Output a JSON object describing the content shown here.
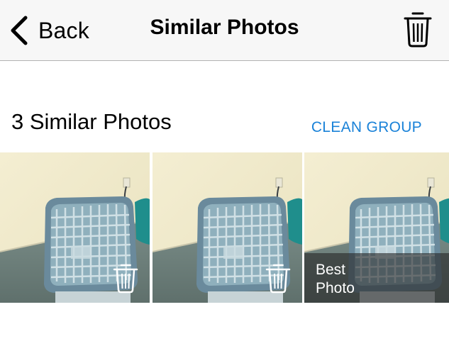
{
  "navbar": {
    "back_label": "Back",
    "title": "Similar Photos",
    "back_icon": "chevron-left-icon",
    "trash_icon": "trash-icon"
  },
  "group": {
    "title": "3 Similar Photos",
    "clean_label": "CLEAN GROUP",
    "accent_color": "#1a82d8"
  },
  "photos": [
    {
      "subject": "box fan",
      "action_icon": "trash-icon"
    },
    {
      "subject": "box fan",
      "action_icon": "trash-icon"
    },
    {
      "subject": "box fan",
      "badge": "Best Photo"
    }
  ]
}
